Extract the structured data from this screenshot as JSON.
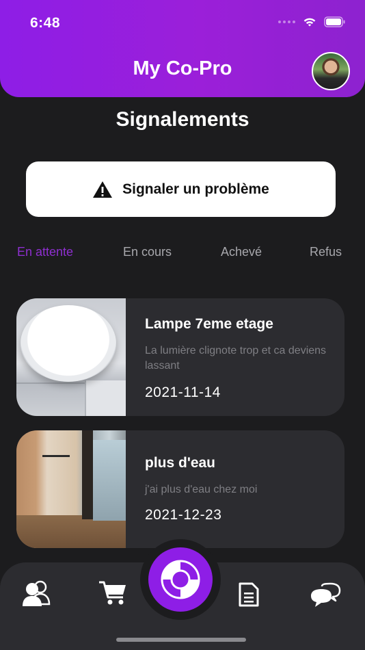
{
  "status_bar": {
    "time": "6:48"
  },
  "header": {
    "app_title": "My Co-Pro"
  },
  "page": {
    "title": "Signalements"
  },
  "report_button": {
    "label": "Signaler un problème",
    "icon": "warning-icon"
  },
  "tabs": [
    {
      "label": "En attente",
      "active": true
    },
    {
      "label": "En cours",
      "active": false
    },
    {
      "label": "Achevé",
      "active": false
    },
    {
      "label": "Refus",
      "active": false
    }
  ],
  "reports": [
    {
      "title": "Lampe 7eme etage",
      "description": "La lumière clignote trop et ca deviens lassant",
      "date": "2021-11-14",
      "image": "ceiling-lamp-photo"
    },
    {
      "title": "plus d'eau",
      "description": "j'ai plus d'eau chez moi",
      "date": "2021-12-23",
      "image": "room-photo"
    }
  ],
  "bottom_nav": {
    "items": [
      "users-icon",
      "cart-icon",
      "lifebuoy-icon",
      "document-icon",
      "chat-icon"
    ],
    "accent_color": "#8e1ee6"
  },
  "colors": {
    "accent": "#8e1ee6",
    "active_tab": "#8e2fd0",
    "background": "#1c1c1e",
    "card": "#2c2c30"
  }
}
